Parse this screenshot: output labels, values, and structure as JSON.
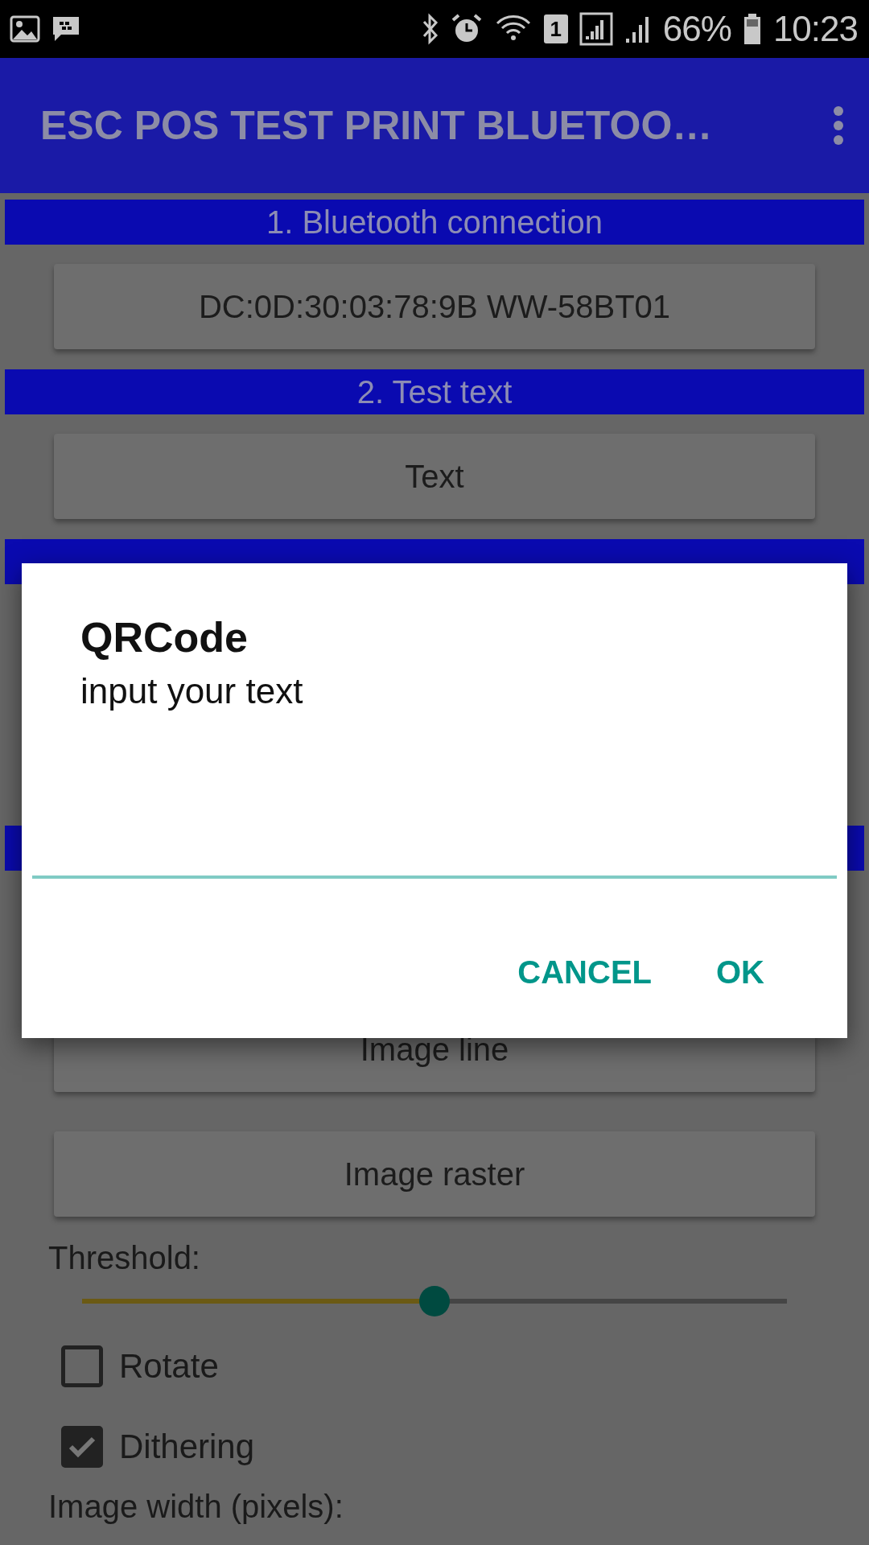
{
  "status_bar": {
    "sim_slot": "1",
    "battery": "66%",
    "time": "10:23"
  },
  "app_bar": {
    "title": "ESC POS TEST PRINT BLUETOO…"
  },
  "content": [
    {
      "kind": "header",
      "label": "1. Bluetooth connection"
    },
    {
      "kind": "button",
      "label": "DC:0D:30:03:78:9B WW-58BT01"
    },
    {
      "kind": "header",
      "label": "2. Test text"
    },
    {
      "kind": "button",
      "label": "Text"
    },
    {
      "kind": "header"
    },
    {
      "kind": "header"
    },
    {
      "kind": "button",
      "label": "Image line"
    },
    {
      "kind": "button",
      "label": "Image raster"
    },
    {
      "kind": "label",
      "label": "Threshold:"
    },
    {
      "kind": "slider",
      "level": 0.5
    },
    {
      "kind": "checkbox",
      "label": "Rotate",
      "checked": false
    },
    {
      "kind": "checkbox",
      "label": "Dithering",
      "checked": true
    },
    {
      "kind": "label",
      "label": "Image width (pixels):"
    }
  ],
  "dialog": {
    "title": "QRCode",
    "message": "input your text",
    "buttons": [
      "CANCEL",
      "OK"
    ]
  }
}
